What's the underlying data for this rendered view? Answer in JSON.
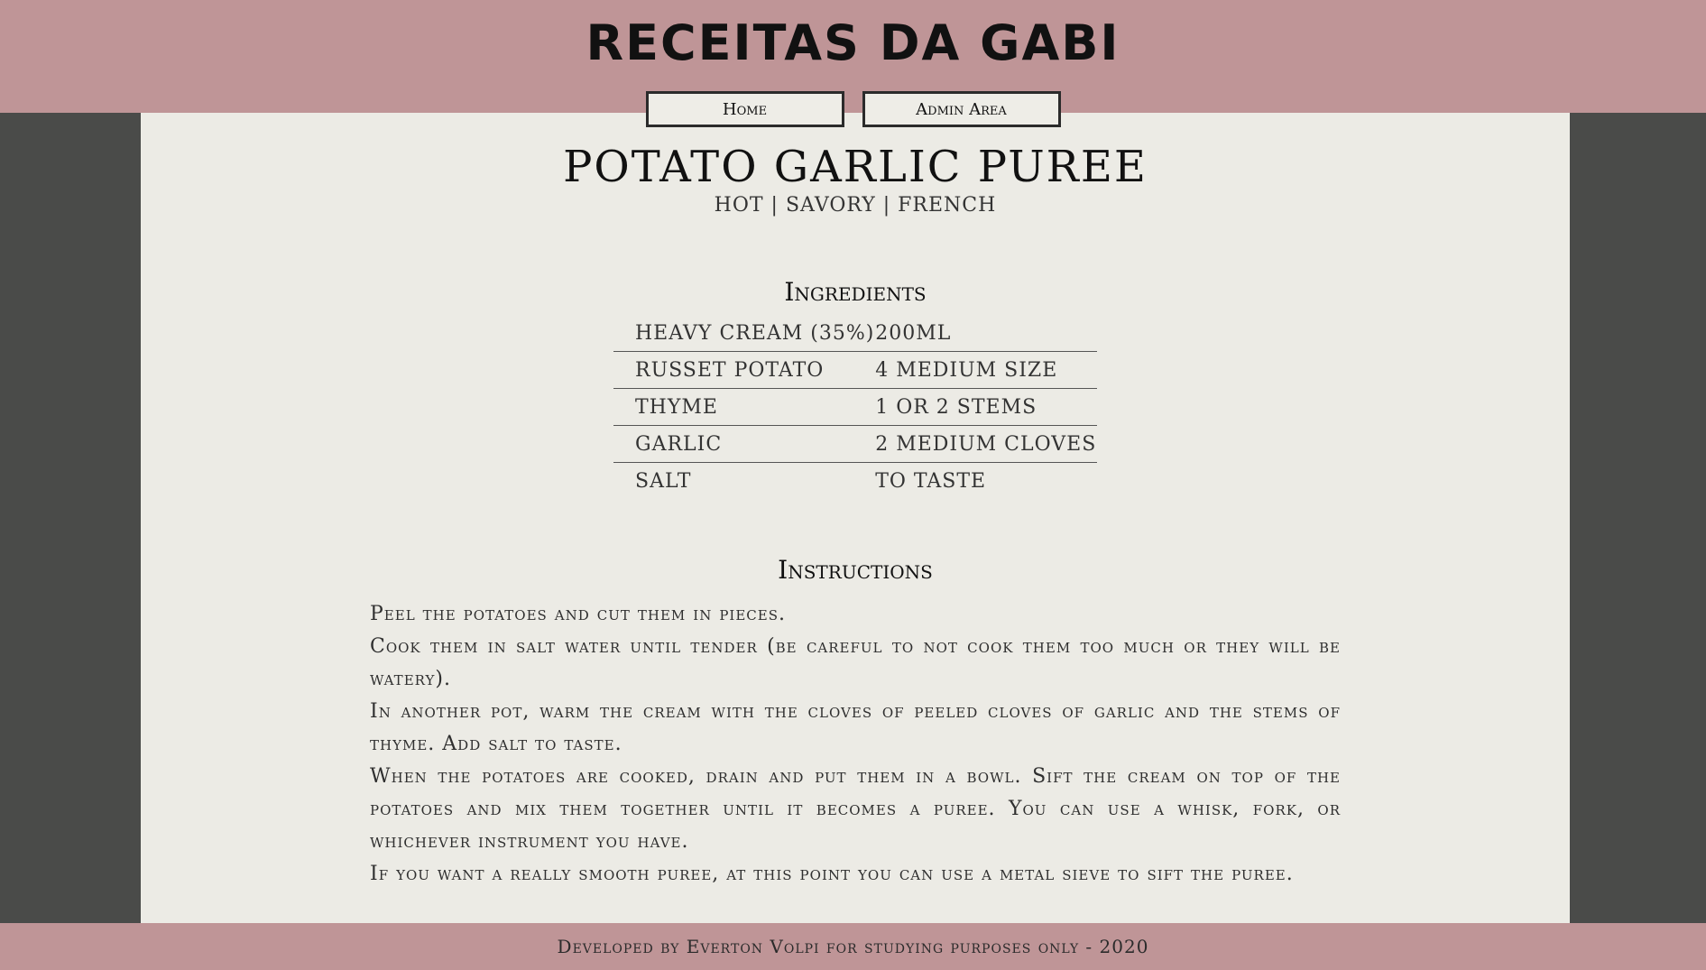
{
  "site": {
    "title": "RECEITAS DA GABI"
  },
  "nav": {
    "home_label": "Home",
    "admin_label": "Admin Area"
  },
  "recipe": {
    "title": "POTATO GARLIC PUREE",
    "tags": "HOT | SAVORY | FRENCH",
    "ingredients_heading": "Ingredients",
    "ingredients": [
      {
        "name": "HEAVY CREAM (35%)",
        "amount": "200ML"
      },
      {
        "name": "RUSSET POTATO",
        "amount": "4 MEDIUM SIZE"
      },
      {
        "name": "THYME",
        "amount": "1 OR 2 STEMS"
      },
      {
        "name": "GARLIC",
        "amount": "2 MEDIUM CLOVES"
      },
      {
        "name": "SALT",
        "amount": "TO TASTE"
      }
    ],
    "instructions_heading": "Instructions",
    "instructions": [
      "Peel the potatoes and cut them in pieces.",
      "Cook them in salt water until tender (be careful to not cook them too much or they will be watery).",
      "In another pot, warm the cream with the cloves of peeled cloves of garlic and the stems of thyme. Add salt to taste.",
      "When the potatoes are cooked, drain and put them in a bowl. Sift the cream on top of the potatoes and mix them together until it becomes a puree. You can use a whisk, fork, or whichever instrument you have.",
      "If you want a really smooth puree, at this point you can use a metal sieve to sift the puree."
    ]
  },
  "footer": {
    "text": "Developed by Everton Volpi for studying purposes only - 2020"
  },
  "colors": {
    "header_bg": "#bf9597",
    "page_bg": "#4a4b49",
    "content_bg": "#ecebe5"
  }
}
